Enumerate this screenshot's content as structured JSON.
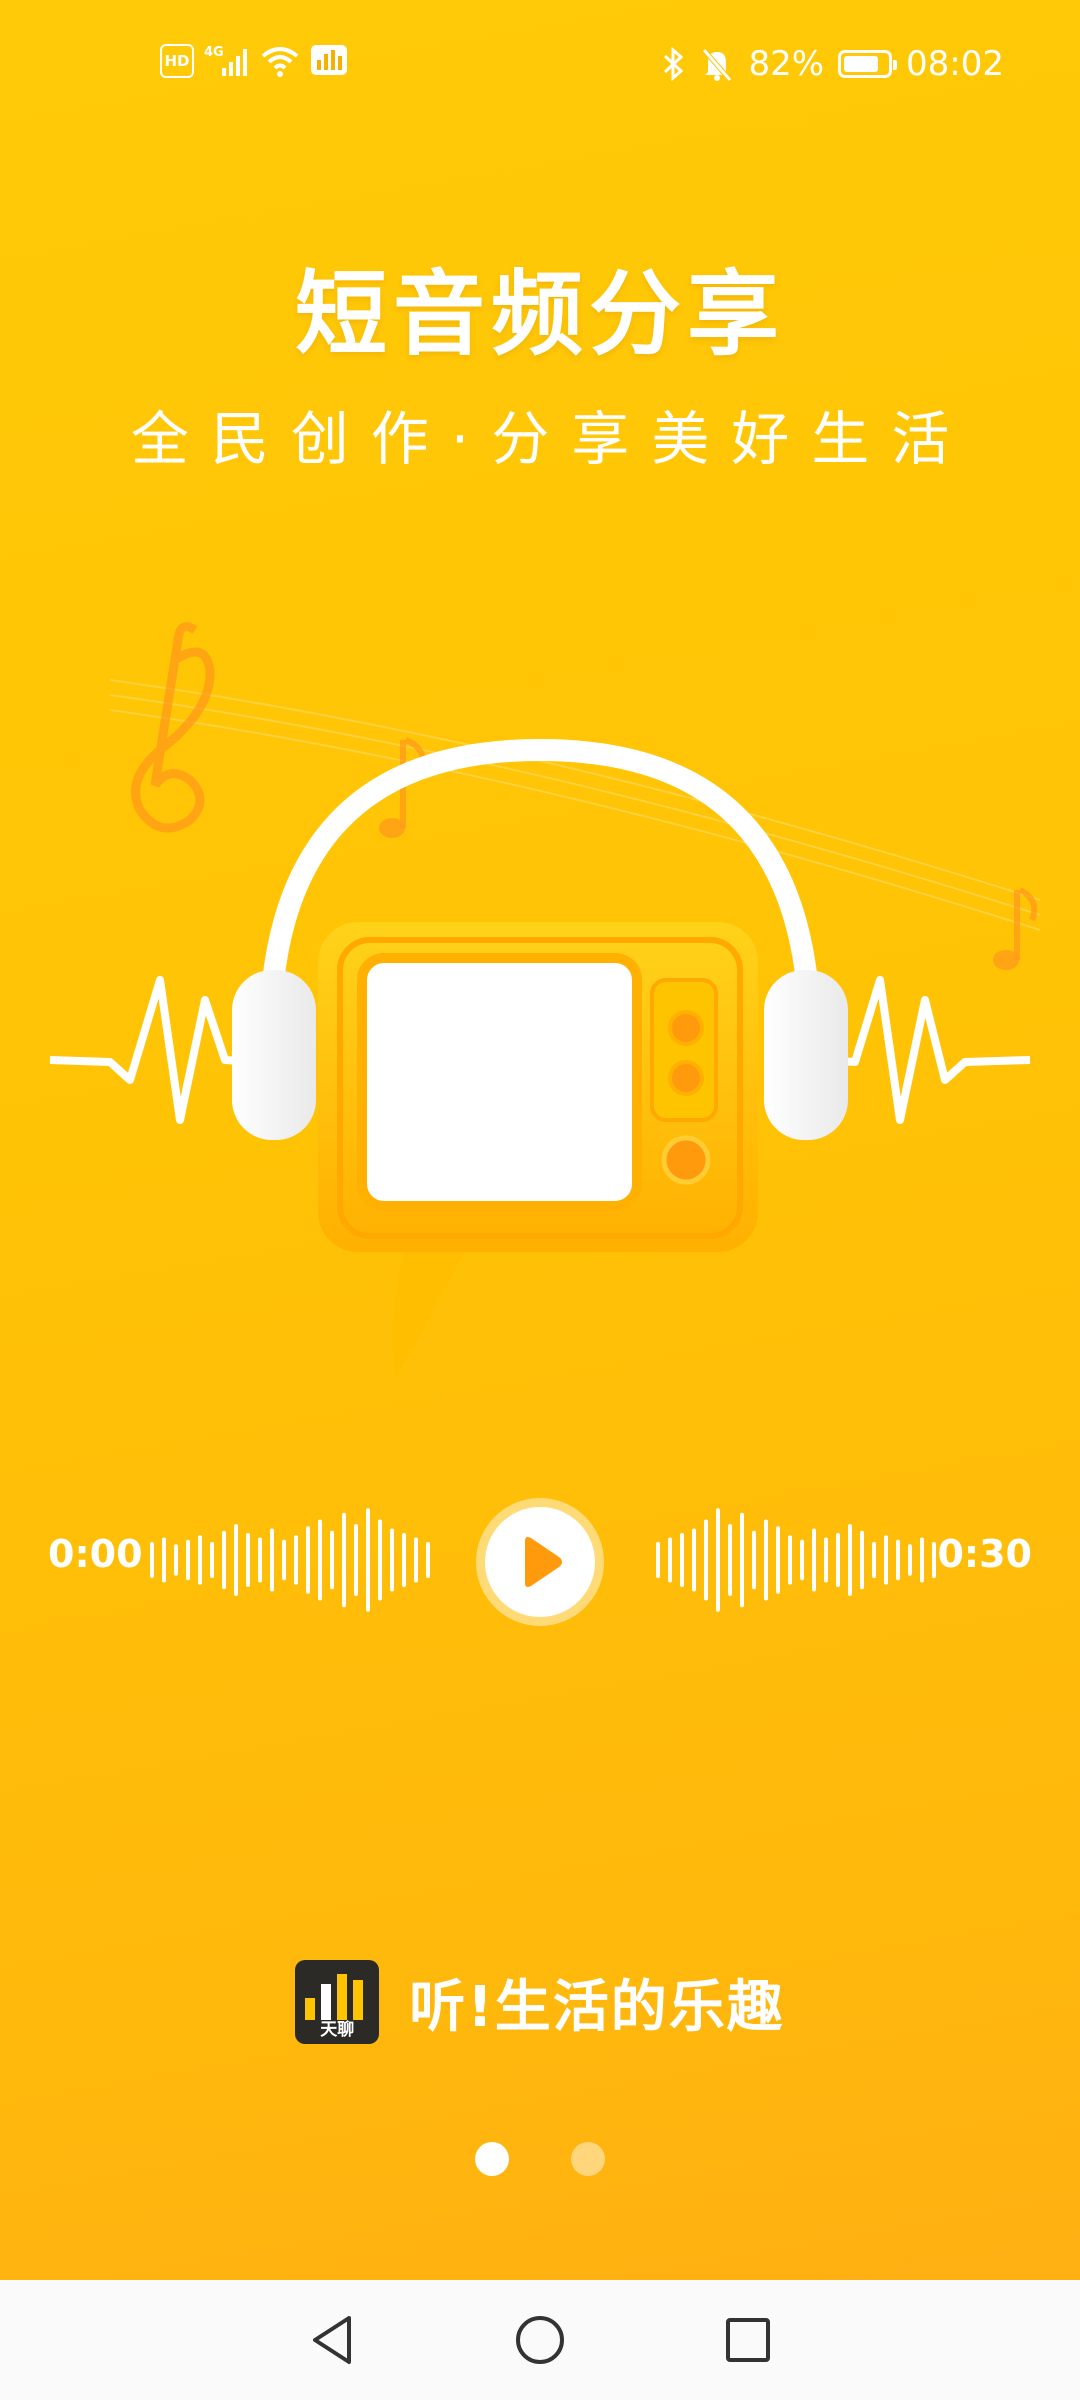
{
  "status_bar": {
    "hd_label": "HD",
    "network": "4G",
    "battery": "82%",
    "battery_level": 0.82,
    "time": "08:02",
    "icons": [
      "hd-icon",
      "signal-icon",
      "wifi-icon",
      "data-app-icon",
      "bluetooth-icon",
      "mute-bell-icon",
      "battery-icon"
    ]
  },
  "hero": {
    "title": "短音频分享",
    "subtitle": "全民创作·分享美好生活"
  },
  "player": {
    "time_start": "0:00",
    "time_end": "0:30",
    "play_icon": "play-icon"
  },
  "brand": {
    "logo_label": "天聊",
    "slogan": "听!生活的乐趣"
  },
  "pager": {
    "total_pages": 2,
    "current_page": 1
  },
  "nav": {
    "icons": [
      "back-icon",
      "home-icon",
      "recents-icon"
    ]
  },
  "colors": {
    "background_top": "#ffca08",
    "background_bottom": "#ffad14",
    "accent_orange": "#ff9a0d",
    "text": "#ffffff"
  }
}
